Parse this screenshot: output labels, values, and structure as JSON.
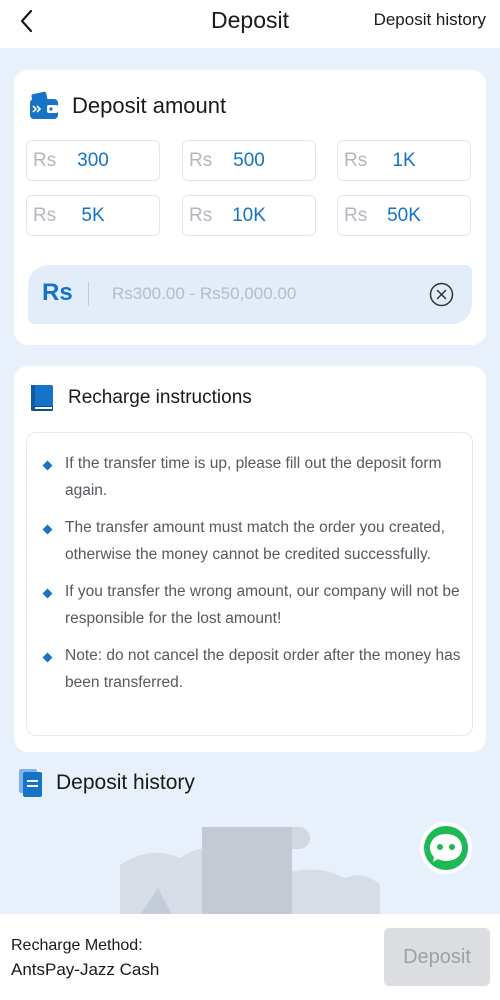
{
  "header": {
    "title": "Deposit",
    "history_link": "Deposit history"
  },
  "amount_card": {
    "title": "Deposit amount",
    "currency": "Rs",
    "presets": [
      "300",
      "500",
      "1K",
      "5K",
      "10K",
      "50K"
    ],
    "input_prefix": "Rs",
    "input_placeholder": "Rs300.00 - Rs50,000.00"
  },
  "instructions": {
    "title": "Recharge instructions",
    "items": [
      "If the transfer time is up, please fill out the deposit form again.",
      "The transfer amount must match the order you created, otherwise the money cannot be credited successfully.",
      "If you transfer the wrong amount, our company will not be responsible for the lost amount!",
      "Note: do not cancel the deposit order after the money has been transferred."
    ]
  },
  "history": {
    "title": "Deposit history"
  },
  "footer": {
    "method_label": "Recharge Method:",
    "method_value": "AntsPay-Jazz Cash",
    "deposit_button": "Deposit"
  },
  "colors": {
    "accent": "#1573c8",
    "page_bg": "#e8f1fb",
    "chat_green": "#1db954",
    "disabled_button": "#dcdde1"
  }
}
